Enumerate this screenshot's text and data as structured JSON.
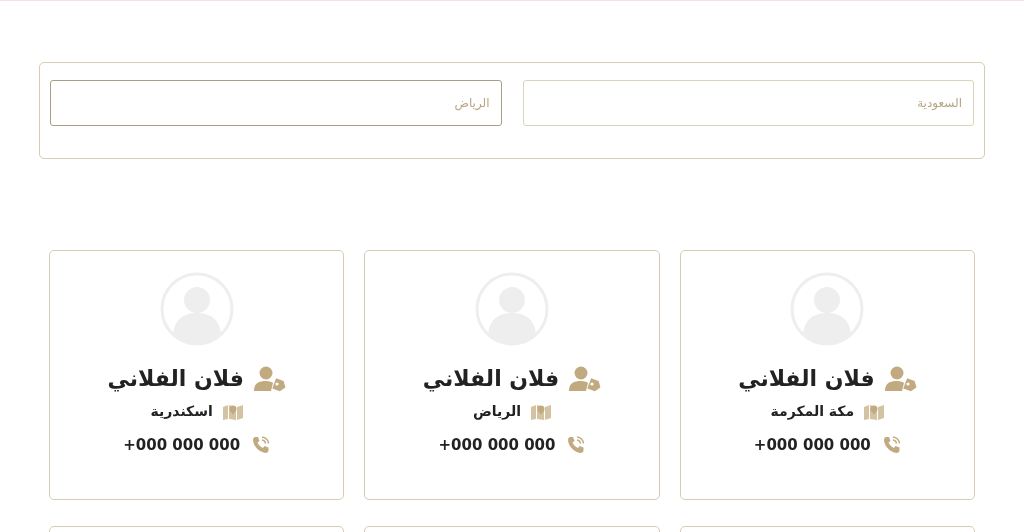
{
  "filters": [
    {
      "value": "السعودية",
      "focused": false
    },
    {
      "value": "الرياض",
      "focused": true
    }
  ],
  "cards": [
    {
      "name": "فلان الفلاني",
      "city": "مكة المكرمة",
      "phone": "+000 000 000"
    },
    {
      "name": "فلان الفلاني",
      "city": "الرياض",
      "phone": "+000 000 000"
    },
    {
      "name": "فلان الفلاني",
      "city": "اسكندرية",
      "phone": "+000 000 000"
    }
  ]
}
